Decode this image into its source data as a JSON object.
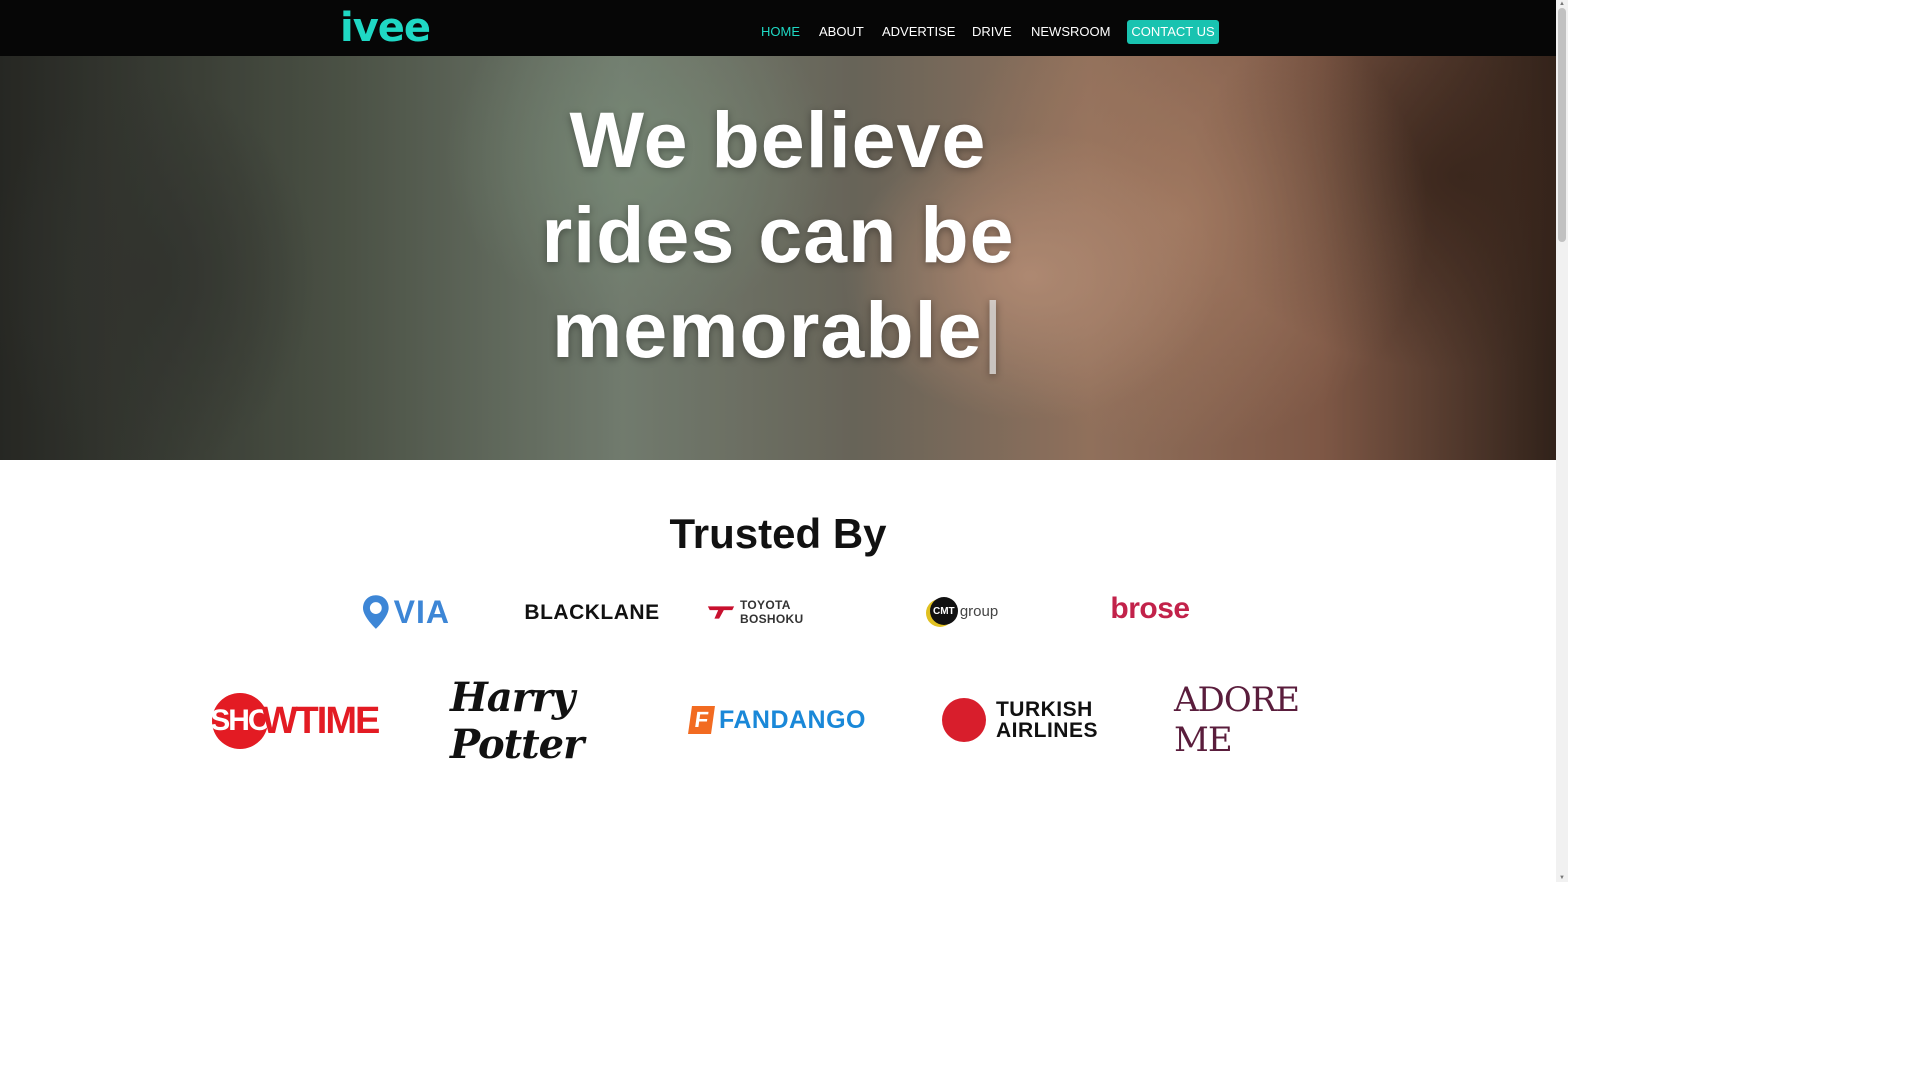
{
  "header": {
    "logo_text": "ivee",
    "nav": [
      "HOME",
      "ABOUT",
      "ADVERTISE",
      "DRIVE",
      "NEWSROOM"
    ],
    "cta_label": "CONTACT US",
    "active_item": "HOME"
  },
  "hero": {
    "line1": "We believe",
    "line2": "rides can be",
    "line3": "memorable",
    "caret": "|"
  },
  "trusted": {
    "title": "Trusted By",
    "logos_row1": {
      "via": "VIA",
      "blacklane": "BLACKLANE",
      "toyota": "TOYOTA BOSHOKU",
      "cmt_mark": "CMT",
      "cmt_word": "group",
      "brose": "brose"
    },
    "logos_row2": {
      "showtime_mark": "SHO",
      "showtime_word": "WTIME",
      "harry_potter": "Harry Potter",
      "fandango_mark": "F",
      "fandango_word": "FANDANGO",
      "turkish_line1": "TURKISH",
      "turkish_line2": "AIRLINES",
      "adore_me": "ADORE ME"
    }
  },
  "colors": {
    "brand_teal": "#1fd8c4",
    "cta_bg": "#19c3b0",
    "header_bg": "#060606"
  },
  "icons": [
    "via-pin-icon",
    "toyota-boshoku-icon",
    "turkish-airlines-icon",
    "scroll-up-arrow",
    "scroll-down-arrow"
  ]
}
